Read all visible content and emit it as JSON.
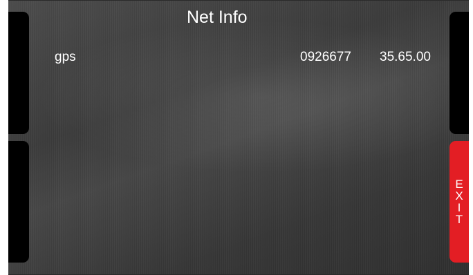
{
  "title": "Net Info",
  "rows": [
    {
      "name": "gps",
      "id": "0926677",
      "version": "35.65.00"
    }
  ],
  "exit_label": "EXIT",
  "colors": {
    "exit": "#e31e24",
    "side_buttons": "#000000",
    "text": "#ffffff"
  }
}
